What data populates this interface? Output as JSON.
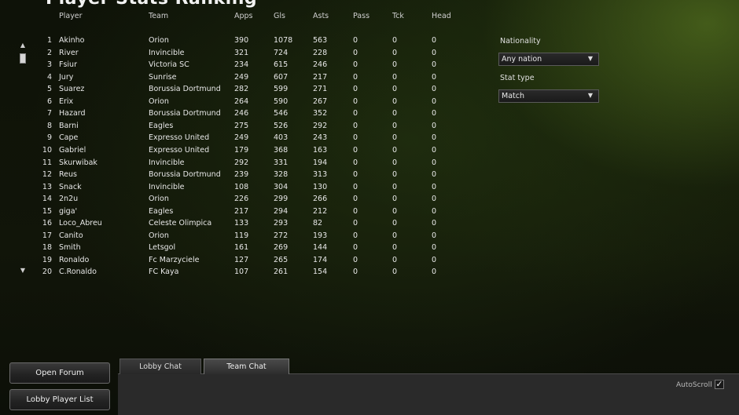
{
  "title": "Player Stats Ranking",
  "columns": {
    "player": "Player",
    "team": "Team",
    "apps": "Apps",
    "gls": "Gls",
    "asts": "Asts",
    "pass": "Pass",
    "tck": "Tck",
    "head": "Head"
  },
  "rows": [
    {
      "rank": "1",
      "player": "Akinho",
      "team": "Orion",
      "apps": "390",
      "gls": "1078",
      "asts": "563",
      "pass": "0",
      "tck": "0",
      "head": "0"
    },
    {
      "rank": "2",
      "player": "River",
      "team": "Invincible",
      "apps": "321",
      "gls": "724",
      "asts": "228",
      "pass": "0",
      "tck": "0",
      "head": "0"
    },
    {
      "rank": "3",
      "player": "Fsiur",
      "team": "Victoria SC",
      "apps": "234",
      "gls": "615",
      "asts": "246",
      "pass": "0",
      "tck": "0",
      "head": "0"
    },
    {
      "rank": "4",
      "player": "Jury",
      "team": "Sunrise",
      "apps": "249",
      "gls": "607",
      "asts": "217",
      "pass": "0",
      "tck": "0",
      "head": "0"
    },
    {
      "rank": "5",
      "player": "Suarez",
      "team": "Borussia Dortmund",
      "apps": "282",
      "gls": "599",
      "asts": "271",
      "pass": "0",
      "tck": "0",
      "head": "0"
    },
    {
      "rank": "6",
      "player": "Erix",
      "team": "Orion",
      "apps": "264",
      "gls": "590",
      "asts": "267",
      "pass": "0",
      "tck": "0",
      "head": "0"
    },
    {
      "rank": "7",
      "player": "Hazard",
      "team": "Borussia Dortmund",
      "apps": "246",
      "gls": "546",
      "asts": "352",
      "pass": "0",
      "tck": "0",
      "head": "0"
    },
    {
      "rank": "8",
      "player": "Barni",
      "team": "Eagles",
      "apps": "275",
      "gls": "526",
      "asts": "292",
      "pass": "0",
      "tck": "0",
      "head": "0"
    },
    {
      "rank": "9",
      "player": "Cape",
      "team": "Expresso United",
      "apps": "249",
      "gls": "403",
      "asts": "243",
      "pass": "0",
      "tck": "0",
      "head": "0"
    },
    {
      "rank": "10",
      "player": "Gabriel",
      "team": "Expresso United",
      "apps": "179",
      "gls": "368",
      "asts": "163",
      "pass": "0",
      "tck": "0",
      "head": "0"
    },
    {
      "rank": "11",
      "player": "Skurwibak",
      "team": "Invincible",
      "apps": "292",
      "gls": "331",
      "asts": "194",
      "pass": "0",
      "tck": "0",
      "head": "0"
    },
    {
      "rank": "12",
      "player": "Reus",
      "team": "Borussia Dortmund",
      "apps": "239",
      "gls": "328",
      "asts": "313",
      "pass": "0",
      "tck": "0",
      "head": "0"
    },
    {
      "rank": "13",
      "player": "Snack",
      "team": "Invincible",
      "apps": "108",
      "gls": "304",
      "asts": "130",
      "pass": "0",
      "tck": "0",
      "head": "0"
    },
    {
      "rank": "14",
      "player": "2n2u",
      "team": "Orion",
      "apps": "226",
      "gls": "299",
      "asts": "266",
      "pass": "0",
      "tck": "0",
      "head": "0"
    },
    {
      "rank": "15",
      "player": "giga'",
      "team": "Eagles",
      "apps": "217",
      "gls": "294",
      "asts": "212",
      "pass": "0",
      "tck": "0",
      "head": "0"
    },
    {
      "rank": "16",
      "player": "Loco_Abreu",
      "team": "Celeste Olimpica",
      "apps": "133",
      "gls": "293",
      "asts": "82",
      "pass": "0",
      "tck": "0",
      "head": "0"
    },
    {
      "rank": "17",
      "player": "Canito",
      "team": "Orion",
      "apps": "119",
      "gls": "272",
      "asts": "193",
      "pass": "0",
      "tck": "0",
      "head": "0"
    },
    {
      "rank": "18",
      "player": "Smith",
      "team": "Letsgol",
      "apps": "161",
      "gls": "269",
      "asts": "144",
      "pass": "0",
      "tck": "0",
      "head": "0"
    },
    {
      "rank": "19",
      "player": "Ronaldo",
      "team": "Fc Marzyciele",
      "apps": "127",
      "gls": "265",
      "asts": "174",
      "pass": "0",
      "tck": "0",
      "head": "0"
    },
    {
      "rank": "20",
      "player": "C.Ronaldo",
      "team": "FC Kaya",
      "apps": "107",
      "gls": "261",
      "asts": "154",
      "pass": "0",
      "tck": "0",
      "head": "0"
    }
  ],
  "filters": {
    "nationality_label": "Nationality",
    "nationality_value": "Any nation",
    "stat_type_label": "Stat type",
    "stat_type_value": "Match"
  },
  "buttons": {
    "open_forum": "Open Forum",
    "lobby_player_list": "Lobby Player List"
  },
  "tabs": [
    {
      "label": "Lobby Chat",
      "active": false
    },
    {
      "label": "Team Chat",
      "active": true
    }
  ],
  "autoscroll": {
    "label": "AutoScroll",
    "checked": true,
    "mark": "✓"
  },
  "icons": {
    "scroll_up": "▲",
    "scroll_down": "▼",
    "dropdown": "▼"
  }
}
